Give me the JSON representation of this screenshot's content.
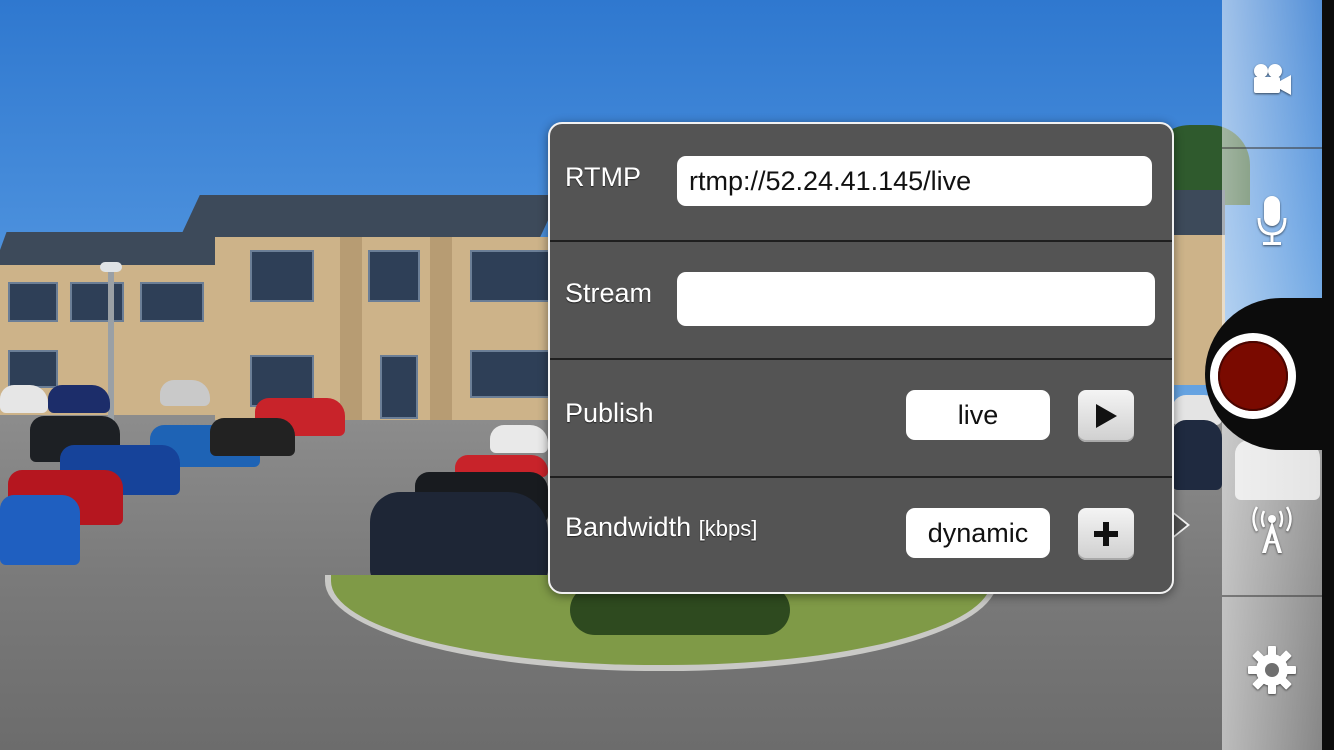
{
  "stream_settings": {
    "rtmp": {
      "label": "RTMP",
      "value": "rtmp://52.24.41.145/live"
    },
    "stream": {
      "label": "Stream",
      "value": ""
    },
    "publish": {
      "label": "Publish",
      "mode": "live",
      "action_icon": "play-icon"
    },
    "bandwidth": {
      "label": "Bandwidth",
      "unit": "[kbps]",
      "mode": "dynamic",
      "action_icon": "plus-icon"
    }
  },
  "toolbar": {
    "items": [
      {
        "name": "video-camera",
        "icon": "video-camera-icon"
      },
      {
        "name": "microphone",
        "icon": "microphone-icon"
      },
      {
        "name": "record",
        "icon": "record-icon"
      },
      {
        "name": "broadcast",
        "icon": "broadcast-antenna-icon"
      },
      {
        "name": "settings",
        "icon": "gear-icon"
      }
    ]
  },
  "colors": {
    "popover_bg": "#545454",
    "popover_border": "#f2f2f2",
    "record": "#7a0a00",
    "toolbar_edge": "#0c0c0c"
  }
}
